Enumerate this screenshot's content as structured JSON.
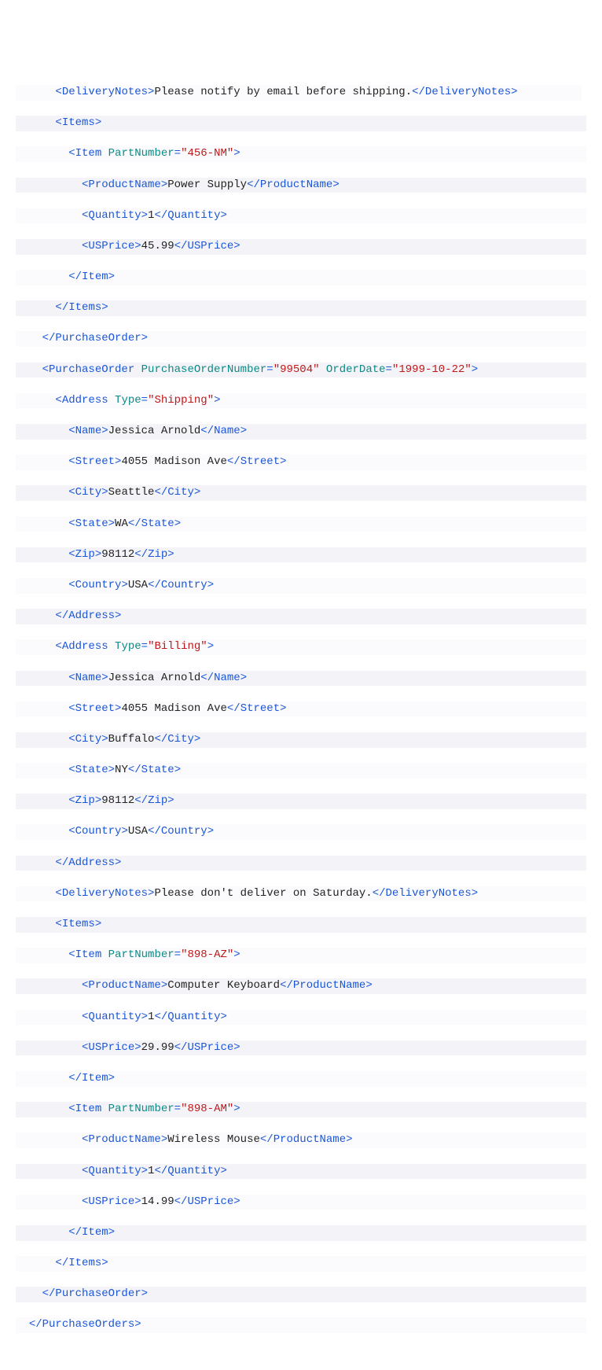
{
  "code": {
    "po1": {
      "deliveryNotes": "Please notify by email before shipping.",
      "item1": {
        "partNumber": "456-NM",
        "productName": "Power Supply",
        "quantity": "1",
        "usPrice": "45.99"
      }
    },
    "po2": {
      "orderNumber": "99504",
      "orderDate": "1999-10-22",
      "shipping": {
        "type": "Shipping",
        "name": "Jessica Arnold",
        "street": "4055 Madison Ave",
        "city": "Seattle",
        "state": "WA",
        "zip": "98112",
        "country": "USA"
      },
      "billing": {
        "type": "Billing",
        "name": "Jessica Arnold",
        "street": "4055 Madison Ave",
        "city": "Buffalo",
        "state": "NY",
        "zip": "98112",
        "country": "USA"
      },
      "deliveryNotes": "Please don't deliver on Saturday.",
      "item1": {
        "partNumber": "898-AZ",
        "productName": "Computer Keyboard",
        "quantity": "1",
        "usPrice": "29.99"
      },
      "item2": {
        "partNumber": "898-AM",
        "productName": "Wireless Mouse",
        "quantity": "1",
        "usPrice": "14.99"
      }
    },
    "tags": {
      "DeliveryNotes": "DeliveryNotes",
      "Items": "Items",
      "Item": "Item",
      "PartNumber": "PartNumber",
      "ProductName": "ProductName",
      "Quantity": "Quantity",
      "USPrice": "USPrice",
      "PurchaseOrder": "PurchaseOrder",
      "PurchaseOrderNumber": "PurchaseOrderNumber",
      "OrderDate": "OrderDate",
      "Address": "Address",
      "Type": "Type",
      "Name": "Name",
      "Street": "Street",
      "City": "City",
      "State": "State",
      "Zip": "Zip",
      "Country": "Country",
      "PurchaseOrders": "PurchaseOrders"
    }
  }
}
